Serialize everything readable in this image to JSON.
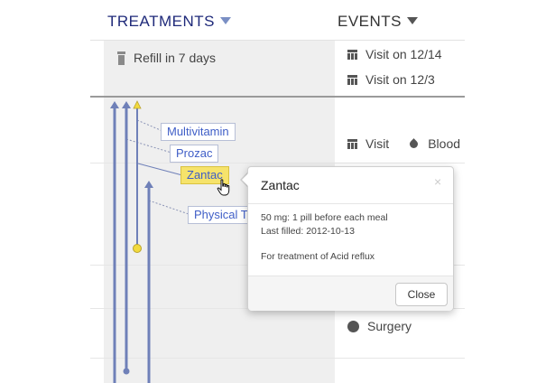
{
  "header": {
    "treatments_label": "TREATMENTS",
    "events_label": "EVENTS"
  },
  "summary": {
    "refill_text": "Refill in 7 days",
    "events": [
      {
        "icon": "calendar-icon",
        "label": "Visit on 12/14"
      },
      {
        "icon": "calendar-icon",
        "label": "Visit on 12/3"
      }
    ]
  },
  "treatments": [
    {
      "label": "Multivitamin"
    },
    {
      "label": "Prozac"
    },
    {
      "label": "Zantac",
      "selected": true
    },
    {
      "label": "Physical T"
    }
  ],
  "events": [
    {
      "icon": "calendar-icon",
      "label": "Visit"
    },
    {
      "icon": "drop-icon",
      "label": "Blood"
    },
    {
      "icon": "dot-icon",
      "label": "Surgery"
    }
  ],
  "popover": {
    "title": "Zantac",
    "close_glyph": "×",
    "dosage": "50 mg: 1 pill before each meal",
    "last_filled": "Last filled: 2012-10-13",
    "purpose": "For treatment of Acid reflux",
    "close_button_label": "Close"
  },
  "colors": {
    "accent_blue": "#6f80b8",
    "marker_yellow": "#f2da3e",
    "selected_highlight": "#f6e36b"
  }
}
